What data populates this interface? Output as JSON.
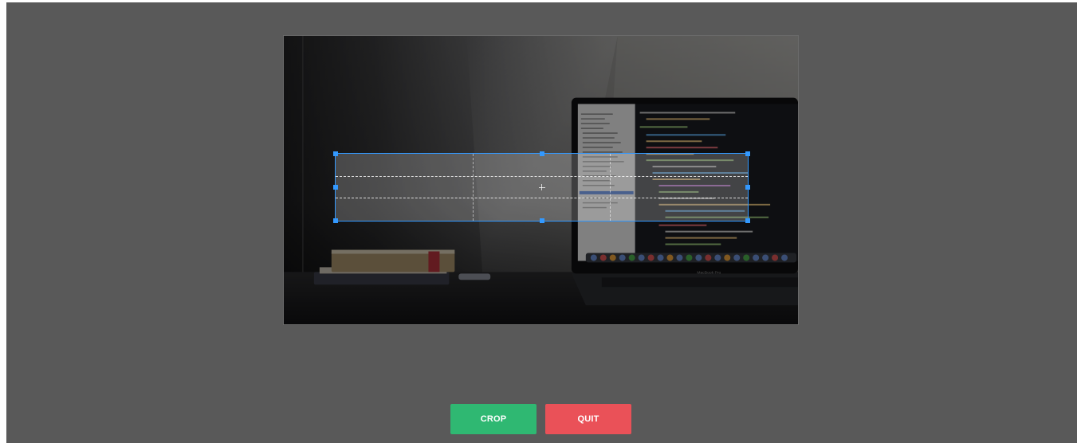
{
  "actions": {
    "crop_label": "CROP",
    "quit_label": "QUIT"
  },
  "photo": {
    "laptop_caption": "MacBook Pro"
  },
  "colors": {
    "background": "#595959",
    "crop_button": "#2fb872",
    "quit_button": "#ea5158",
    "selection": "#3399ff"
  },
  "icons": {
    "selection_handles": "square-handle-icon",
    "center_marker": "crosshair-icon"
  }
}
